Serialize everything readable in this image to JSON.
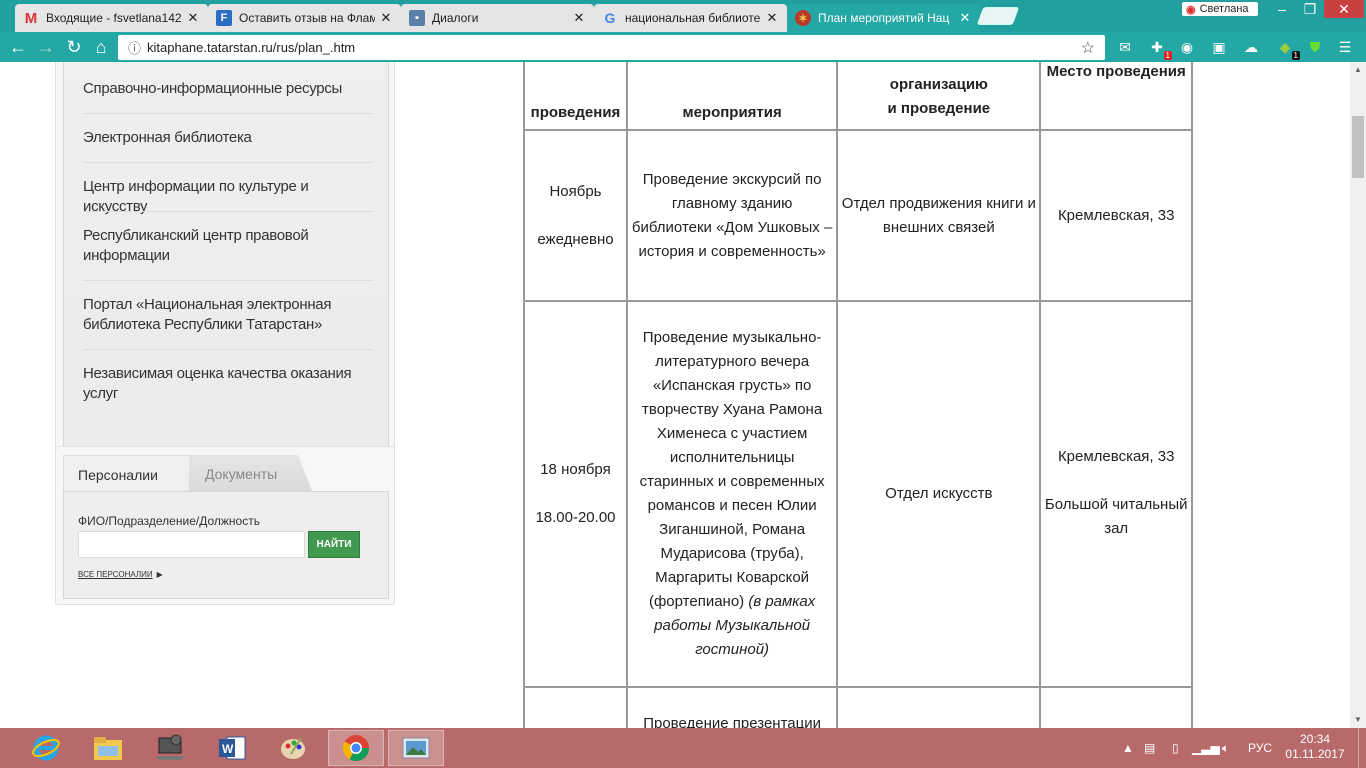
{
  "browser": {
    "tabs": [
      {
        "title": "Входящие - fsvetlana142",
        "icon": "gmail-icon"
      },
      {
        "title": "Оставить отзыв на Флам",
        "icon": "flamp-icon"
      },
      {
        "title": "Диалоги",
        "icon": "dialogs-icon"
      },
      {
        "title": "национальная библиоте",
        "icon": "google-icon"
      },
      {
        "title": "План мероприятий Нац",
        "icon": "library-icon"
      }
    ],
    "profile_name": "Светлана",
    "url": "kitaphane.tatarstan.ru/rus/plan_.htm",
    "extension_badges": [
      "1",
      "1"
    ]
  },
  "sidebar": {
    "items": [
      "Справочно-информационные ресурсы",
      "Электронная библиотека",
      "Центр информации по культуре и искусству",
      "Республиканский центр правовой информации",
      "Портал «Национальная электронная библиотека Республики Татарстан»",
      "Независимая оценка качества оказания услуг"
    ]
  },
  "personnel": {
    "tab_active": "Персоналии",
    "tab_inactive": "Документы",
    "field_label": "ФИО/Подразделение/Должность",
    "field_value": "",
    "search_button": "НАЙТИ",
    "all_link": "ВСЕ ПЕРСОНАЛИИ",
    "all_link_arrow": "▶"
  },
  "table": {
    "header": {
      "col1": "проведения",
      "col2": "мероприятия",
      "col3_line1": "организацию",
      "col3_line2": "и проведение",
      "col4": "Место проведения"
    },
    "rows": [
      {
        "date_line1": "Ноябрь",
        "date_line2": "ежедневно",
        "event": "Проведение экскурсий по главному зданию библиотеки «Дом Ушковых – история и современность»",
        "event_note": "",
        "department": "Отдел продвижения книги и внешних связей",
        "place_line1": "Кремлевская, 33",
        "place_line2": ""
      },
      {
        "date_line1": "18 ноября",
        "date_line2": "18.00-20.00",
        "event": "Проведение музыкально-литературного вечера «Испанская грусть» по творчеству Хуана Рамона Хименеса с участием исполнительницы старинных и современных романсов и песен Юлии Зиганшиной, Романа Мударисова (труба), Маргариты Коварской (фортепиано)",
        "event_note": "(в рамках работы Музыкальной гостиной)",
        "department": "Отдел искусств",
        "place_line1": "Кремлевская, 33",
        "place_line2": "Большой читальный зал"
      },
      {
        "date_line1": "",
        "date_line2": "",
        "event": "Проведение презентации",
        "event_note": "",
        "department": "",
        "place_line1": "",
        "place_line2": ""
      }
    ]
  },
  "taskbar": {
    "language": "РУС",
    "time": "20:34",
    "date": "01.11.2017"
  }
}
